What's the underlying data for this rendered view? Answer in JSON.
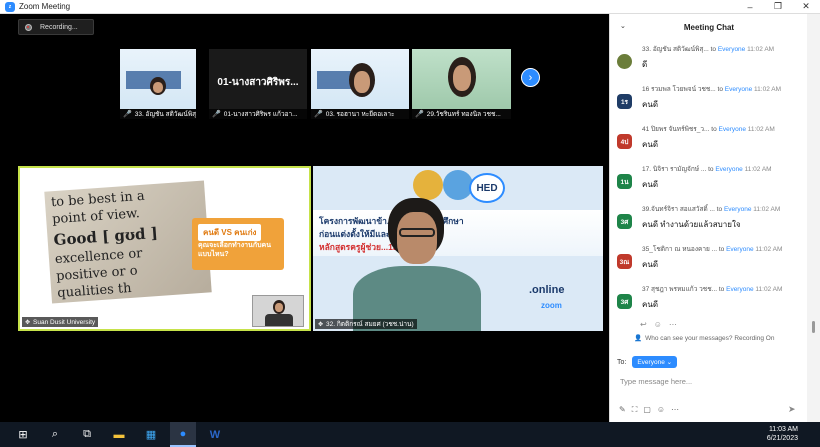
{
  "window": {
    "title": "Zoom Meeting"
  },
  "meeting": {
    "recording_label": "Recording...",
    "thumbnails": [
      {
        "name": "33. อัญชัน สติวัฒน์พิสุ...",
        "muted": true
      },
      {
        "name": "01-นางสาวศิริพร  แก้วอา...",
        "muted": true,
        "tile_text": "01-นางสาวศิริพร..."
      },
      {
        "name": "03. รอฮานา หะยีดอเลาะ",
        "muted": true
      },
      {
        "name": "29.วัชรินทร์ ทองนิล วชช...",
        "muted": true
      }
    ],
    "main_left": {
      "label": "Suan Dusit University",
      "dict_lines": [
        "to be best in a",
        "point of view.",
        "Good [ gʊd ]",
        "excellence or",
        "positive or o",
        "qualities th"
      ],
      "card_title": "คนดี VS คนเก่ง",
      "card_sub": "คุณจะเลือกทำงานกับคนแบบไหน?"
    },
    "main_right": {
      "label": "32. กิตติกรณ์ สมยศ (วชช.น่าน)",
      "banner_line1": "โครงการพัฒนาข้า...ลากรทางการศึกษา",
      "banner_line2": "ก่อนแต่งตั้งให้มีและ...",
      "banner_line3": "หลักสูตรครูผู้ช่วย...130",
      "hed": "HED",
      "online": ".online",
      "zoom": "zoom"
    }
  },
  "chat": {
    "title": "Meeting Chat",
    "messages": [
      {
        "sender": "33. อัญชัน สติวัฒน์พิสุ...",
        "to": "to",
        "target": "Everyone",
        "time": "11:02 AM",
        "text": "ดี",
        "avatar": "",
        "avatar_color": "#6b7d3a"
      },
      {
        "sender": "16 รวมพล โวยพจน์ วชช...",
        "to": "to",
        "target": "Everyone",
        "time": "11:02 AM",
        "text": "คนดี",
        "avatar": "1ร",
        "avatar_color": "#1f3c66"
      },
      {
        "sender": "41 ปิยพร จันทร์พิชร_ว...",
        "to": "to",
        "target": "Everyone",
        "time": "11:02 AM",
        "text": "คนดี",
        "avatar": "4ป",
        "avatar_color": "#c0392b"
      },
      {
        "sender": "17. นิจิรา รามัญจักษ์ ...",
        "to": "to",
        "target": "Everyone",
        "time": "11:02 AM",
        "text": "คนดี",
        "avatar": "1น",
        "avatar_color": "#1e8449"
      },
      {
        "sender": "39.จันทร์จิรา สอแสวัสดิ์ ...",
        "to": "to",
        "target": "Everyone",
        "time": "11:02 AM",
        "text": "คนดี ทำงานด้วยแล้วสบายใจ",
        "avatar": "3ศ",
        "avatar_color": "#1e8449"
      },
      {
        "sender": "35_โชติกา ณ หนองคาย ...",
        "to": "to",
        "target": "Everyone",
        "time": "11:02 AM",
        "text": "คนดี",
        "avatar": "3ณ",
        "avatar_color": "#c0392b"
      },
      {
        "sender": "37 สุชฎา พรหมแก้ว วชช...",
        "to": "to",
        "target": "Everyone",
        "time": "11:02 AM",
        "text": "คนดี",
        "avatar": "3ศ",
        "avatar_color": "#1e8449"
      }
    ],
    "visibility_text": "Who can see your messages? Recording On",
    "to_label": "To:",
    "recipient": "Everyone",
    "input_placeholder": "Type message here..."
  },
  "taskbar": {
    "time": "11:03 AM",
    "date": "6/21/2023"
  },
  "colors": {
    "accent": "#2d8cff",
    "active_speaker_border": "#c6e24a",
    "taskbar_bg": "#101823"
  }
}
